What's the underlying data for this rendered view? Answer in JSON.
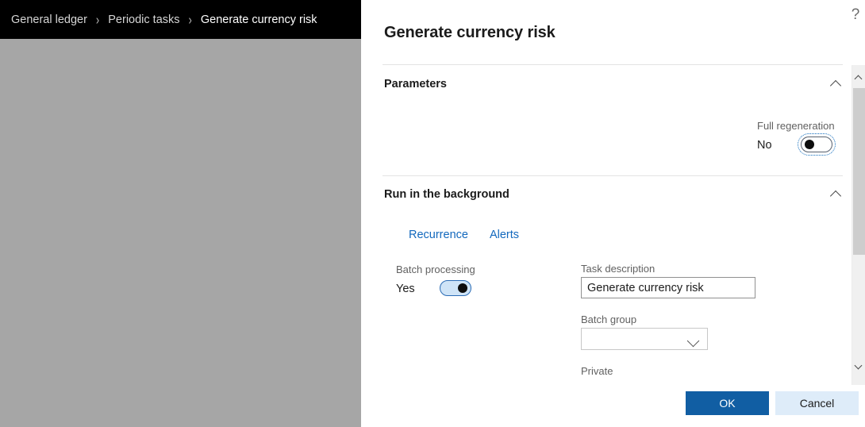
{
  "app": {
    "breadcrumb": [
      {
        "label": "General ledger"
      },
      {
        "label": "Periodic tasks"
      },
      {
        "label": "Generate currency risk"
      }
    ],
    "separator": "›"
  },
  "dialog": {
    "title": "Generate currency risk",
    "help_icon": "?",
    "sections": [
      {
        "title": "Parameters",
        "chevron_icon": "chevron-up-icon",
        "fields": {
          "full_regeneration": {
            "label": "Full regeneration",
            "value_text": "No",
            "state": "off",
            "focused": true
          }
        }
      },
      {
        "title": "Run in the background",
        "chevron_icon": "chevron-up-icon",
        "tabs": [
          {
            "label": "Recurrence"
          },
          {
            "label": "Alerts"
          }
        ],
        "fields": {
          "batch_processing": {
            "label": "Batch processing",
            "value_text": "Yes",
            "state": "on",
            "focused": false
          },
          "task_description": {
            "label": "Task description",
            "value": "Generate currency risk",
            "placeholder": ""
          },
          "batch_group": {
            "label": "Batch group",
            "value": "",
            "chevron_icon": "chevron-down-icon"
          },
          "private": {
            "label": "Private"
          }
        }
      }
    ],
    "scrollbar": {
      "up_icon": "scroll-up-arrow-icon",
      "down_icon": "scroll-down-arrow-icon"
    },
    "footer": {
      "ok_label": "OK",
      "cancel_label": "Cancel"
    }
  },
  "colors": {
    "accent": "#115ea3",
    "link": "#1268bd",
    "cancel_bg": "#deecf9",
    "toggle_on_bg": "#cfe4f7",
    "header_bg": "#000000",
    "overlay_bg": "#a6a6a6"
  }
}
